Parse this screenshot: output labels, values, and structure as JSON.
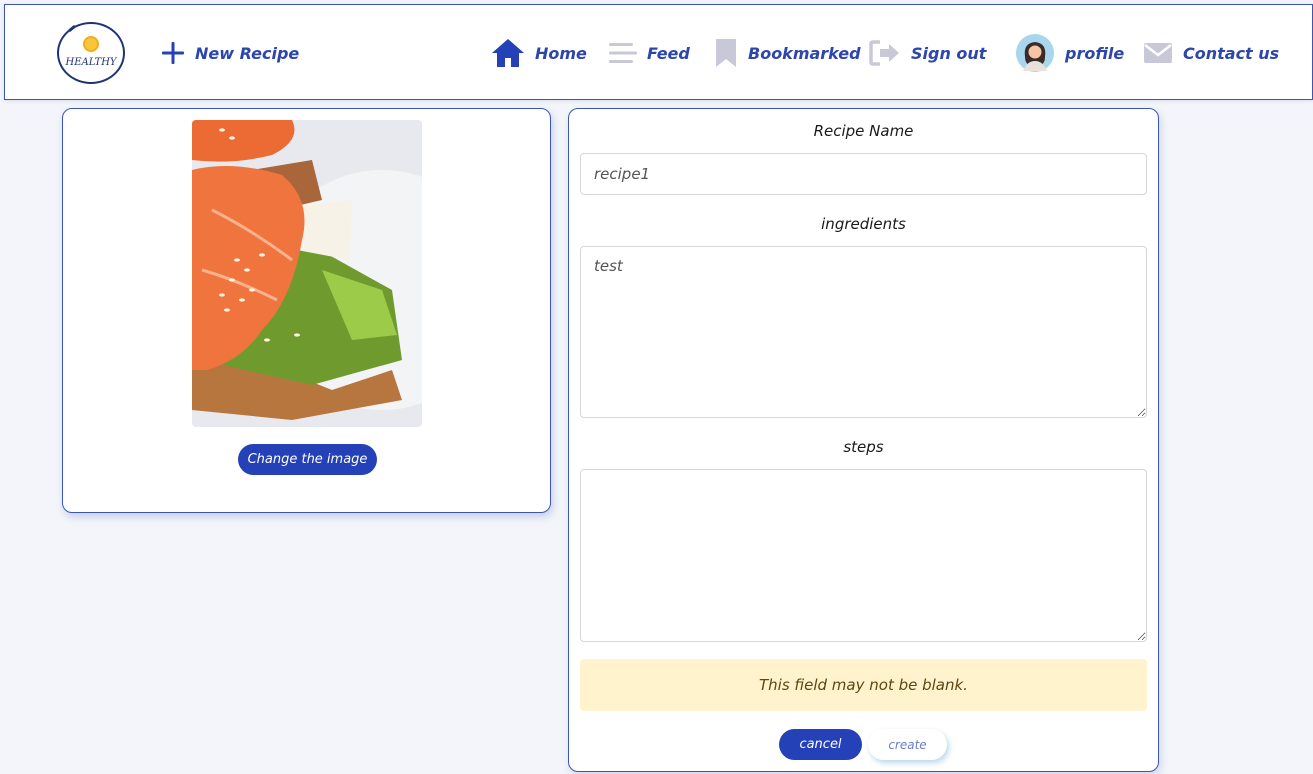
{
  "navbar": {
    "logo_text": "HEALTHY",
    "new_recipe": "New Recipe",
    "home": "Home",
    "feed": "Feed",
    "bookmarked": "Bookmarked",
    "sign_out": "Sign out",
    "profile": "profile",
    "contact": "Contact us"
  },
  "image_card": {
    "change_button": "Change the image"
  },
  "form": {
    "recipe_name_label": "Recipe Name",
    "recipe_name_value": "recipe1",
    "ingredients_label": "ingredients",
    "ingredients_value": "test",
    "steps_label": "steps",
    "steps_value": "",
    "error_message": "This field may not be blank.",
    "cancel_button": "cancel",
    "create_button": "create"
  },
  "colors": {
    "accent": "#2441b8",
    "nav_text": "#2d46ad",
    "icon_muted": "#c8c8d8",
    "alert_bg": "#fff3cd",
    "page_bg": "#f3f5fa"
  },
  "icons": {
    "new_recipe": "plus-icon",
    "home": "home-icon",
    "feed": "menu-lines-icon",
    "bookmarked": "bookmark-icon",
    "sign_out": "sign-out-icon",
    "profile": "avatar-icon",
    "contact": "envelope-icon"
  }
}
